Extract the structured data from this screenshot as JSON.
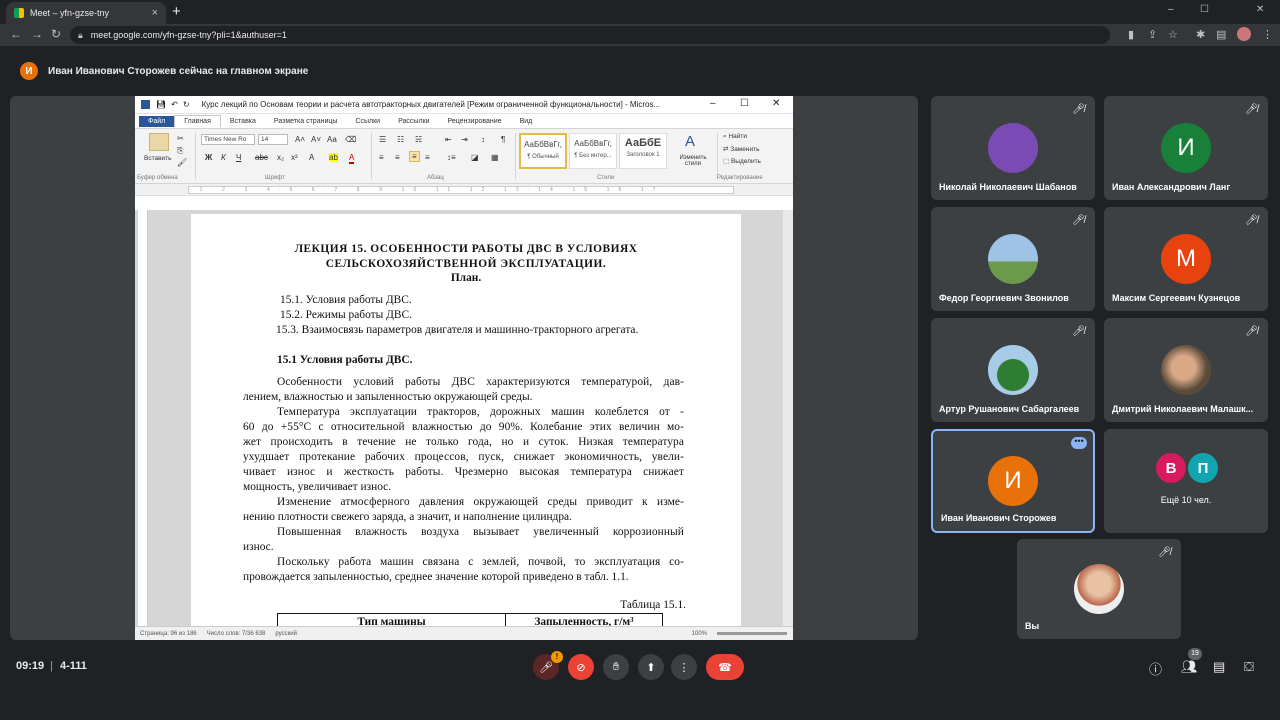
{
  "browser": {
    "tab_title": "Meet – yfn-gzse-tny",
    "new_tab": "+",
    "url": "meet.google.com/yfn-gzse-tny?pli=1&authuser=1",
    "controls": {
      "minimize": "–",
      "maximize": "☐",
      "close": "✕"
    }
  },
  "banner": {
    "avatar_letter": "И",
    "text": "Иван Иванович Сторожев сейчас на главном экране"
  },
  "word": {
    "title": "Курс лекций по Основам теории и расчета автотракторных двигателей [Режим ограниченной функциональности] - Micros...",
    "tabs": [
      "Файл",
      "Главная",
      "Вставка",
      "Разметка страницы",
      "Ссылки",
      "Рассылки",
      "Рецензирование",
      "Вид"
    ],
    "font_name": "Times New Ro",
    "font_size": "14",
    "paste_label": "Вставить",
    "styles": [
      {
        "sample": "АаБбВвГг,",
        "name": "¶ Обычный"
      },
      {
        "sample": "АаБбВвГг,",
        "name": "¶ Без интер..."
      },
      {
        "sample": "АаБбЕ",
        "name": "Заголовок 1"
      }
    ],
    "change_styles": "Изменить стили",
    "find": "Найти",
    "replace": "Заменить",
    "select": "Выделить",
    "groups": {
      "clipboard": "Буфер обмена",
      "font": "Шрифт",
      "paragraph": "Абзац",
      "styles": "Стили",
      "editing": "Редактирование"
    },
    "status": {
      "page": "Страница: 96 из 186",
      "words": "Число слов: 7/36 638",
      "lang": "русский",
      "zoom": "100%"
    }
  },
  "doc": {
    "title1": "ЛЕКЦИЯ 15.   ОСОБЕННОСТИ РАБОТЫ ДВС В УСЛОВИЯХ",
    "title2": "СЕЛЬСКОХОЗЯЙСТВЕННОЙ ЭКСПЛУАТАЦИИ.",
    "plan": "План.",
    "items": [
      "15.1. Условия работы ДВС.",
      "15.2. Режимы работы ДВС.",
      "15.3. Взаимосвязь параметров двигателя и машинно-тракторного агрегата."
    ],
    "section": "15.1 Условия работы ДВС.",
    "lines": [
      "Особенности условий работы ДВС характеризуются температурой, дав-",
      "лением, влажностью и запыленностью окружающей среды.",
      "Температура эксплуатации тракторов, дорожных машин колеблется от -",
      "60 до +55°С с относительной влажностью до 90%. Колебание этих величин мо-",
      "жет происходить в течение не только года, но и суток. Низкая температура",
      "ухудшает протекание рабочих процессов, пуск, снижает экономичность, увели-",
      "чивает износ и жесткость работы. Чрезмерно высокая температура снижает",
      "мощность, увеличивает износ.",
      "Изменение атмосферного давления окружающей среды приводит к изме-",
      "нению плотности свежего заряда, а значит, и наполнение цилиндра.",
      "Повышенная влажность воздуха вызывает увеличенный коррозионный",
      "износ.",
      "Поскольку работа машин связана с землей, почвой, то эксплуатация со-",
      "провождается запыленностью, среднее значение которой приведено в табл. 1.1."
    ],
    "table_caption": "Таблица 15.1.",
    "table_headers": [
      "Тип машины",
      "Запыленность, г/м³"
    ]
  },
  "participants": [
    {
      "name": "Николай Николаевич Шабанов",
      "letter": "",
      "color": "#7b4bb5"
    },
    {
      "name": "Иван Александрович Ланг",
      "letter": "И",
      "color": "#188038"
    },
    {
      "name": "Федор Георгиевич Звонилов",
      "letter": "",
      "color": "#6c8fb2"
    },
    {
      "name": "Максим Сергеевич Кузнецов",
      "letter": "М",
      "color": "#e8430f"
    },
    {
      "name": "Артур Рушанович Сабаргалеев",
      "letter": "",
      "color": "#3f8f5a"
    },
    {
      "name": "Дмитрий Николаевич Малашк...",
      "letter": "",
      "color": "#8a6a4a"
    },
    {
      "name": "Иван Иванович Сторожев",
      "letter": "И",
      "color": "#e8710a"
    },
    {
      "name": "Ещё 10 чел.",
      "letter": "",
      "color": ""
    },
    {
      "name": "Вы",
      "letter": "",
      "color": "#c9a27d"
    }
  ],
  "more_avatars": [
    {
      "letter": "В",
      "color": "#d81b60"
    },
    {
      "letter": "П",
      "color": "#12a4af"
    }
  ],
  "bottom": {
    "time": "09:19",
    "separator": "|",
    "meeting": "4-111",
    "people_count": "19"
  }
}
